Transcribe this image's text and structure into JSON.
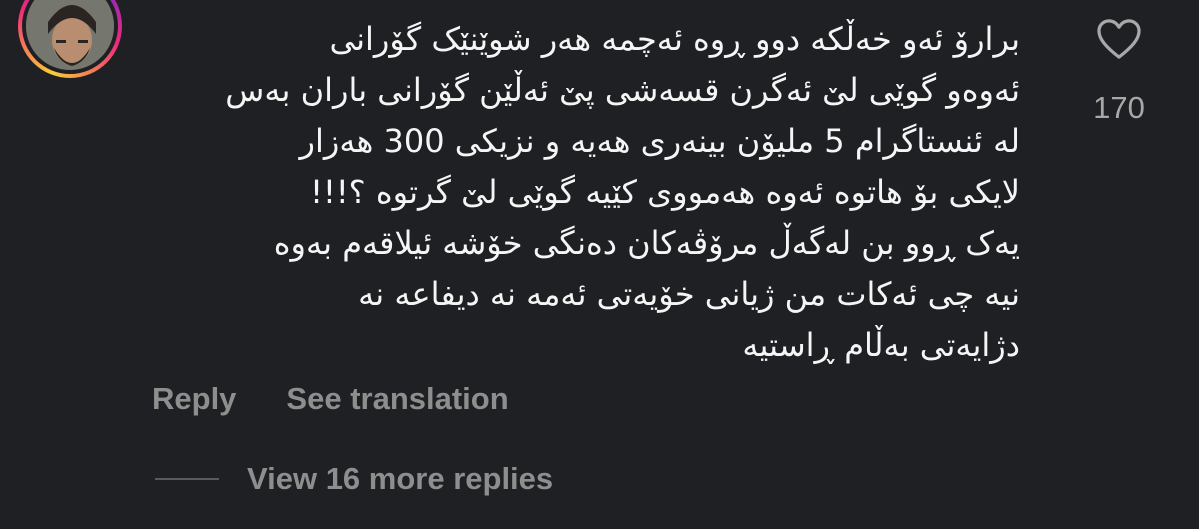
{
  "comment": {
    "lines": [
      "برارۆ ئەو خەڵکە دوو ڕوە ئەچمە هەر شوێنێک گۆرانی",
      "ئەوەو گوێی لێ ئەگرن قسەشی پێ ئەڵێن گۆرانی باران بەس",
      "لە ئنستاگرام 5 ملیۆن بینەری هەیە و نزیکی 300 هەزار",
      "لایکی بۆ هاتوە ئەوە هەمووی کێیە گوێی لێ گرتوە ؟!!!",
      "یەک ڕوو بن لەگەڵ مرۆڤەکان دەنگی خۆشە ئیلاقەم بەوە",
      "نیە چی ئەکات من ژیانی خۆیەتی ئەمە نە دیفاعە نە",
      "دژایەتی بەڵام ڕاستیە"
    ]
  },
  "likes": {
    "icon": "heart-outline",
    "count": "170"
  },
  "actions": {
    "reply_label": "Reply",
    "translate_label": "See translation"
  },
  "replies": {
    "view_more_label": "View 16 more replies"
  },
  "colors": {
    "background": "#1f2023",
    "text": "#f5f5f5",
    "muted": "#8e8e8e",
    "ring_gradient": [
      "#f9ce34",
      "#ee2a7b",
      "#6228d7"
    ]
  }
}
